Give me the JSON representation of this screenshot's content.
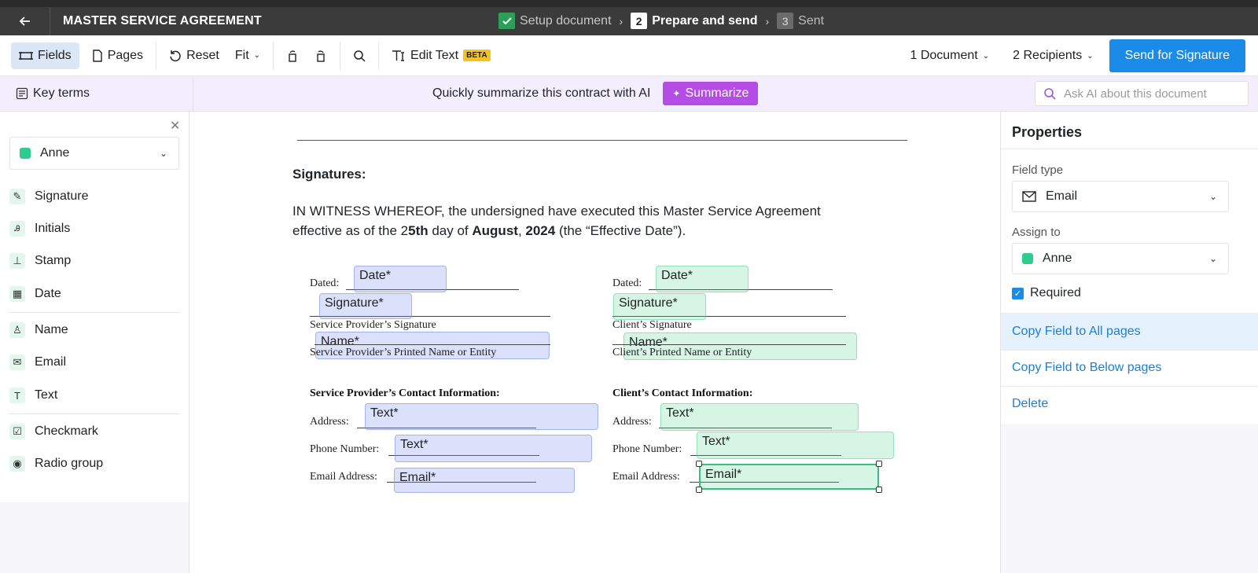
{
  "header": {
    "title": "MASTER SERVICE AGREEMENT",
    "steps": [
      {
        "num": "",
        "label": "Setup document",
        "state": "done"
      },
      {
        "num": "2",
        "label": "Prepare and send",
        "state": "current"
      },
      {
        "num": "3",
        "label": "Sent",
        "state": "future"
      }
    ]
  },
  "toolbar": {
    "fields": "Fields",
    "pages": "Pages",
    "reset": "Reset",
    "fit": "Fit",
    "edit_text": "Edit Text",
    "beta": "BETA",
    "documents": "1 Document",
    "recipients": "2 Recipients",
    "send": "Send for Signature"
  },
  "aibar": {
    "key_terms": "Key terms",
    "prompt": "Quickly summarize this contract with AI",
    "summarize": "Summarize",
    "ask_placeholder": "Ask AI about this document"
  },
  "left_panel": {
    "recipient": "Anne",
    "recipient_color": "#2ecc8f",
    "fields": [
      {
        "label": "Signature",
        "icon": "pen-icon"
      },
      {
        "label": "Initials",
        "icon": "initials-icon"
      },
      {
        "label": "Stamp",
        "icon": "stamp-icon"
      },
      {
        "label": "Date",
        "icon": "calendar-icon"
      },
      {
        "label": "Name",
        "icon": "person-icon"
      },
      {
        "label": "Email",
        "icon": "envelope-icon"
      },
      {
        "label": "Text",
        "icon": "text-icon"
      },
      {
        "label": "Checkmark",
        "icon": "checkbox-icon"
      },
      {
        "label": "Radio group",
        "icon": "radio-icon"
      }
    ]
  },
  "document": {
    "heading": "Signatures:",
    "witness_line1": "IN WITNESS WHEREOF, the undersigned have executed this Master Service Agreement",
    "witness_pre": "effective as of the 2",
    "witness_day": "5th",
    "witness_mid": " day of ",
    "witness_month": "August",
    "witness_comma": ", ",
    "witness_year": "2024",
    "witness_post": " (the “Effective Date”).",
    "left": {
      "dated": "Dated:",
      "sig_caption": "Service Provider’s Signature",
      "name_caption": "Service Provider’s Printed Name or Entity",
      "contact_heading": "Service Provider’s Contact Information:",
      "address": "Address:",
      "phone": "Phone Number:",
      "email": "Email Address:"
    },
    "right": {
      "dated": "Dated:",
      "sig_caption": "Client’s Signature",
      "name_caption": "Client’s Printed Name or Entity",
      "contact_heading": "Client’s Contact Information:",
      "address": "Address:",
      "phone": "Phone Number:",
      "email": "Email Address:"
    },
    "fields": {
      "date": "Date*",
      "signature": "Signature*",
      "name": "Name*",
      "text": "Text*",
      "email": "Email*"
    },
    "colors": {
      "provider": "#7d91f0",
      "client": "#5ad796"
    }
  },
  "properties": {
    "title": "Properties",
    "field_type_label": "Field type",
    "field_type": "Email",
    "assign_label": "Assign to",
    "assignee": "Anne",
    "required": "Required",
    "copy_all": "Copy Field to All pages",
    "copy_below": "Copy Field to Below pages",
    "delete": "Delete"
  }
}
